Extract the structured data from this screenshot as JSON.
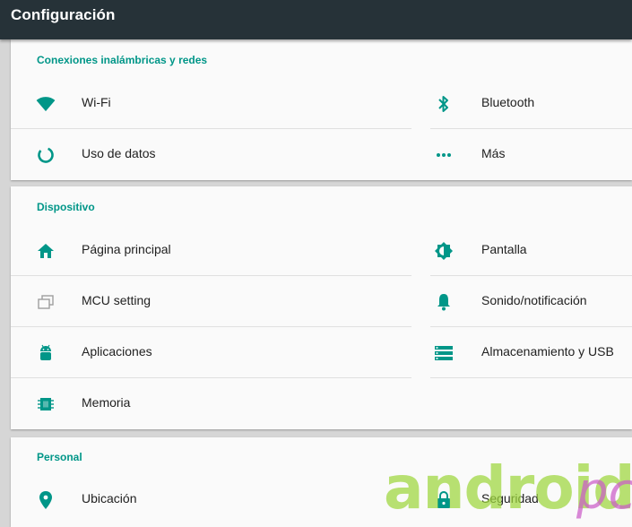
{
  "appbar": {
    "title": "Configuración"
  },
  "sections": [
    {
      "title": "Conexiones inalámbricas y redes",
      "items": [
        {
          "label": "Wi-Fi",
          "icon": "wifi-icon"
        },
        {
          "label": "Bluetooth",
          "icon": "bluetooth-icon"
        },
        {
          "label": "Uso de datos",
          "icon": "data-usage-icon"
        },
        {
          "label": "Más",
          "icon": "more-horiz-icon"
        }
      ]
    },
    {
      "title": "Dispositivo",
      "items": [
        {
          "label": "Página principal",
          "icon": "home-icon"
        },
        {
          "label": "Pantalla",
          "icon": "brightness-icon"
        },
        {
          "label": "MCU setting",
          "icon": "layers-icon"
        },
        {
          "label": "Sonido/notificación",
          "icon": "bell-icon"
        },
        {
          "label": "Aplicaciones",
          "icon": "android-icon"
        },
        {
          "label": "Almacenamiento y USB",
          "icon": "storage-icon"
        },
        {
          "label": "Memoria",
          "icon": "memory-icon"
        }
      ]
    },
    {
      "title": "Personal",
      "items": [
        {
          "label": "Ubicación",
          "icon": "location-icon"
        },
        {
          "label": "Seguridad",
          "icon": "lock-icon"
        }
      ]
    }
  ],
  "watermark": {
    "brand": "android",
    "suffix": "pc"
  },
  "colors": {
    "appbar": "#263238",
    "accent": "#009688",
    "background": "#d6d6d6"
  }
}
